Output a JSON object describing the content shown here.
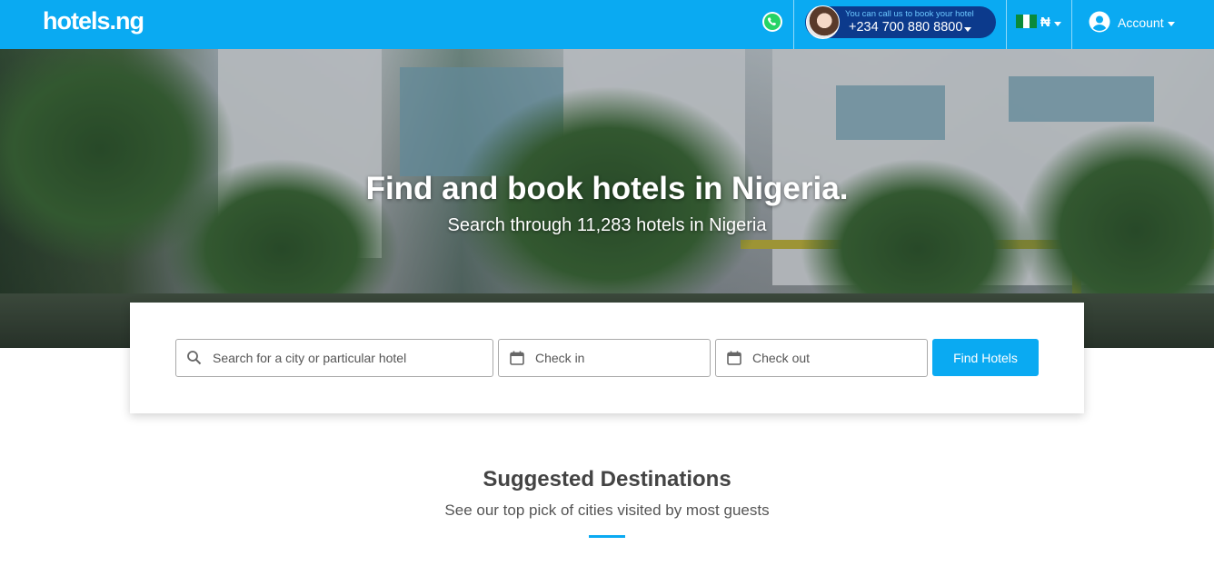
{
  "header": {
    "logo": "hotels.ng",
    "call_hint": "You can call us to book your hotel",
    "phone": "+234 700 880 8800",
    "currency": "₦",
    "account_label": "Account",
    "brand_color": "#0aaaf2",
    "pill_color": "#0c3a8c"
  },
  "hero": {
    "title": "Find and book hotels in Nigeria.",
    "subtitle": "Search through 11,283 hotels in Nigeria"
  },
  "search": {
    "destination_placeholder": "Search for a city or particular hotel",
    "checkin_placeholder": "Check in",
    "checkout_placeholder": "Check out",
    "find_button": "Find Hotels"
  },
  "suggested": {
    "title": "Suggested Destinations",
    "subtitle": "See our top pick of cities visited by most guests"
  },
  "icons": {
    "whatsapp": "whatsapp-icon",
    "search": "search-icon",
    "calendar": "calendar-icon",
    "account": "account-circle-icon",
    "flag": "nigeria-flag-icon"
  }
}
